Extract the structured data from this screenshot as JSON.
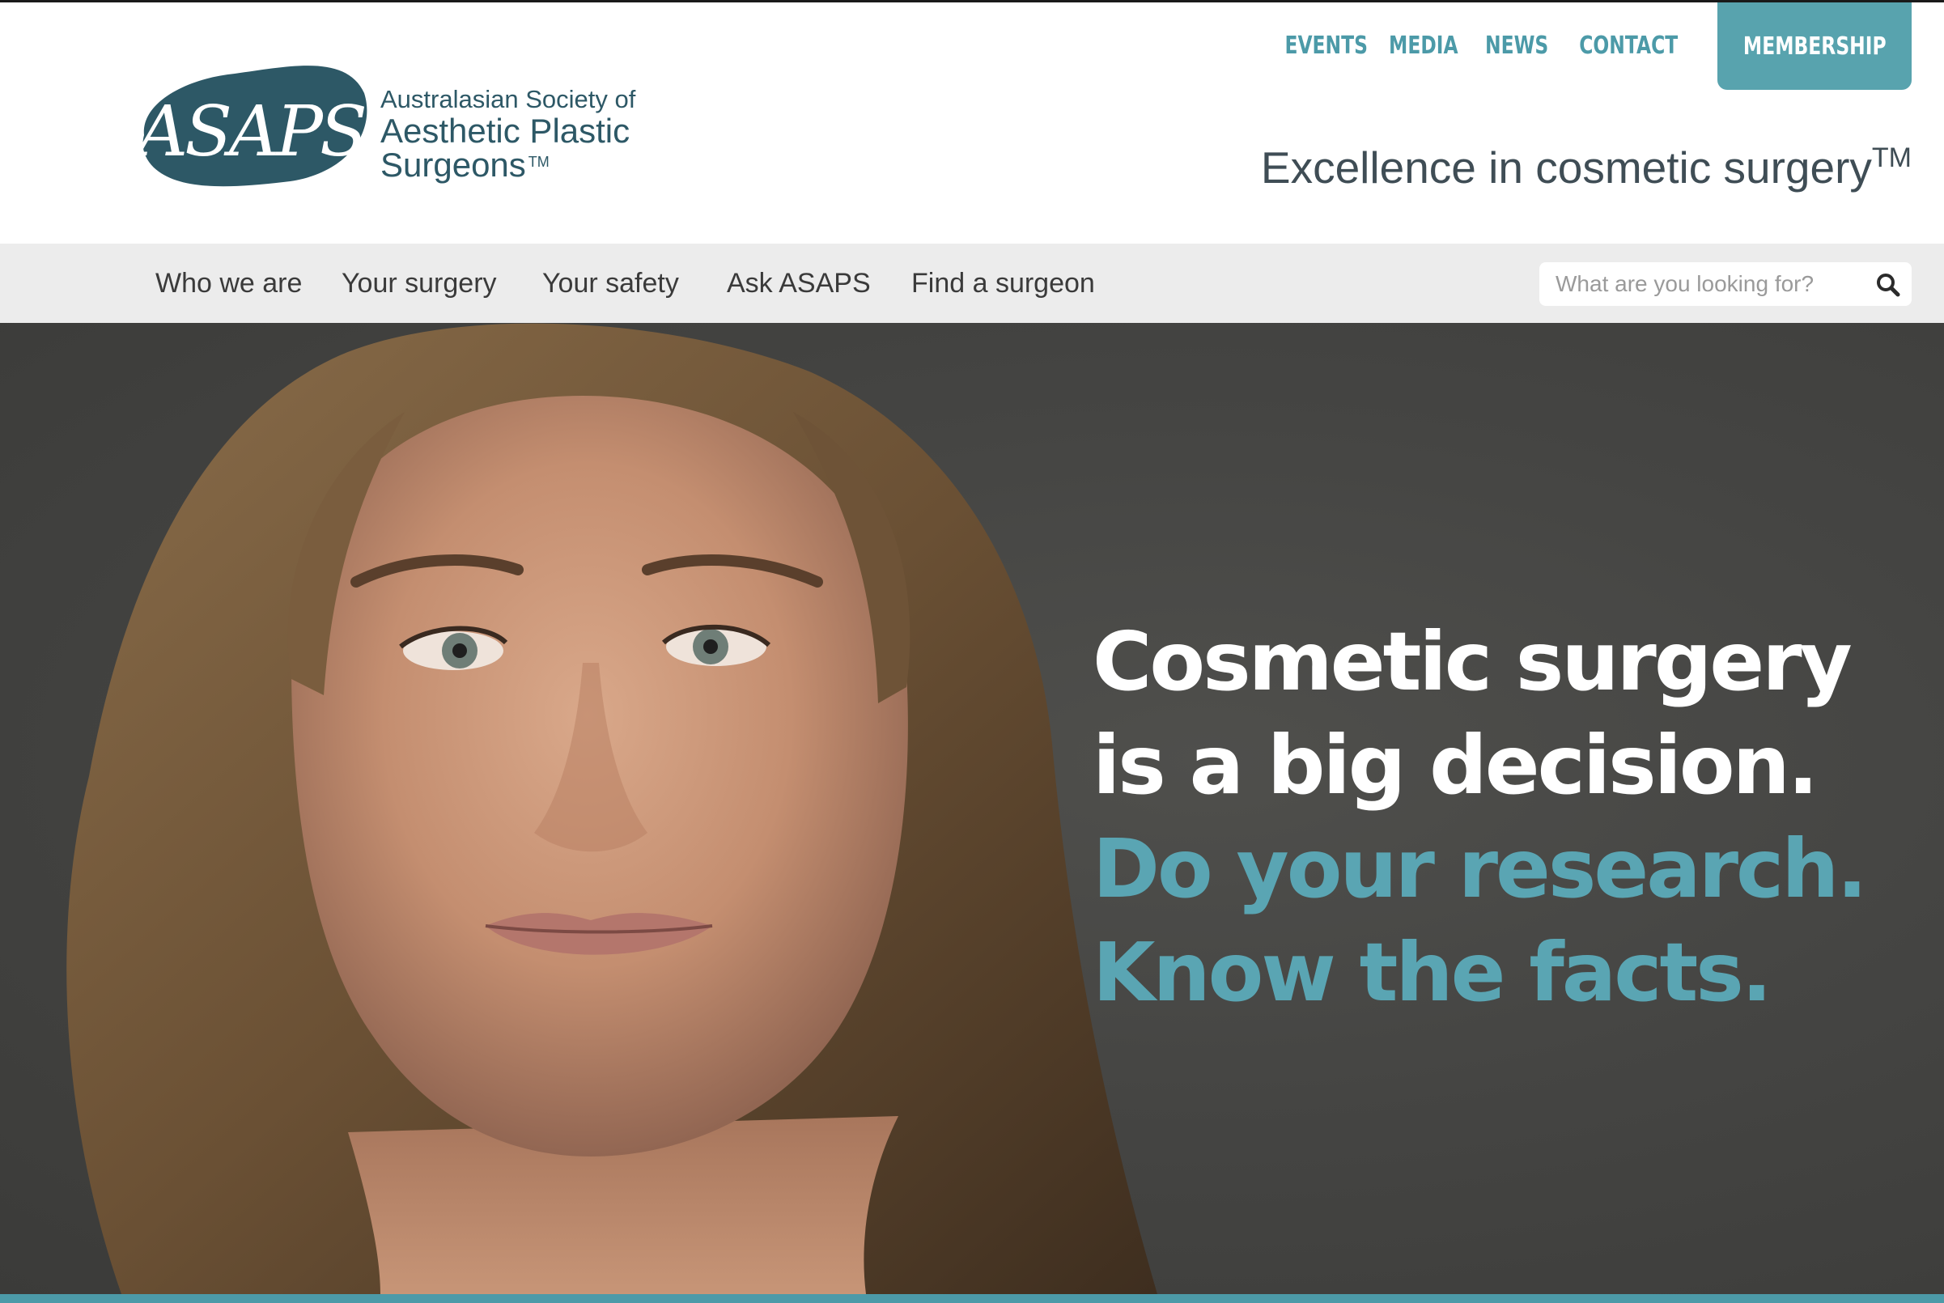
{
  "brand": {
    "logo_text": "ASAPS",
    "org_line1": "Australasian Society of",
    "org_line2": "Aesthetic Plastic",
    "org_line3": "Surgeons",
    "trademark": "TM",
    "tagline": "Excellence in cosmetic surgery",
    "tagline_tm": "TM",
    "colors": {
      "primary": "#2d5866",
      "accent": "#4c9aa8",
      "membership_bg": "#58a3ae"
    }
  },
  "topnav": {
    "events": "EVENTS",
    "media": "MEDIA",
    "news": "NEWS",
    "contact": "CONTACT",
    "membership": "MEMBERSHIP"
  },
  "mainnav": {
    "items": [
      {
        "label": "Who we are"
      },
      {
        "label": "Your surgery"
      },
      {
        "label": "Your safety"
      },
      {
        "label": "Ask ASAPS"
      },
      {
        "label": "Find a surgeon"
      }
    ]
  },
  "search": {
    "placeholder": "What are you looking for?",
    "value": "",
    "icon": "search-icon"
  },
  "hero": {
    "line1": "Cosmetic surgery",
    "line2": "is a big decision.",
    "line3": "Do your research.",
    "line4": "Know the facts."
  }
}
